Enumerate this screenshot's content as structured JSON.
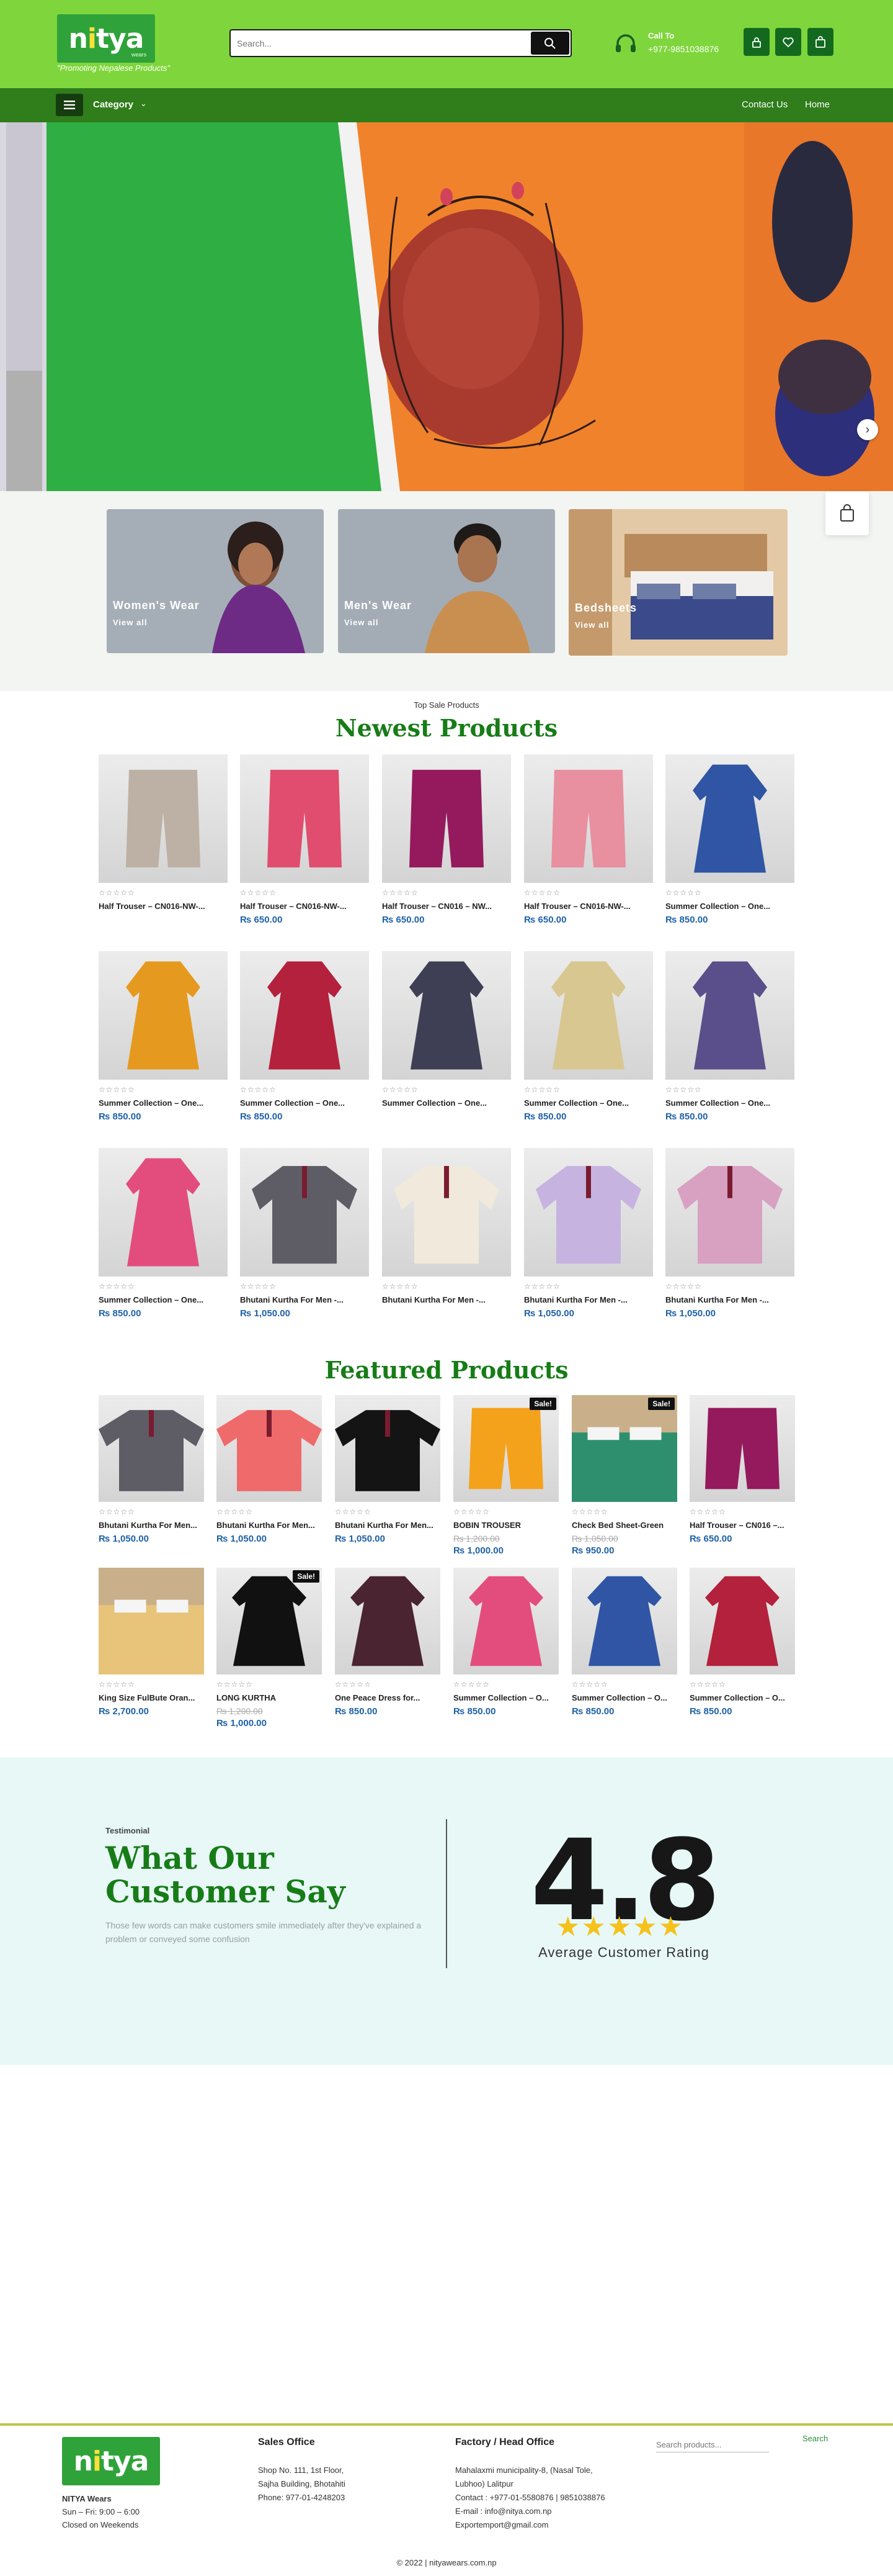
{
  "header": {
    "logo_text_pre": "n",
    "logo_dot": "i",
    "logo_text_post": "tya",
    "logo_sub": "wears",
    "tagline": "\"Promoting Nepalese Products\"",
    "search_placeholder": "Search...",
    "call_label": "Call To",
    "call_number": "+977-9851038876"
  },
  "nav": {
    "category": "Category",
    "links": [
      "Contact Us",
      "Home"
    ]
  },
  "categories": [
    {
      "title": "Women's Wear",
      "link": "View all"
    },
    {
      "title": "Men's Wear",
      "link": "View all"
    },
    {
      "title": "Bedsheets",
      "link": "View all"
    }
  ],
  "newest": {
    "kicker": "Top Sale Products",
    "title": "Newest Products",
    "products": [
      {
        "name": "Half Trouser – CN016-NW-...",
        "price": ""
      },
      {
        "name": "Half Trouser – CN016-NW-...",
        "price": "₨ 650.00"
      },
      {
        "name": "Half Trouser – CN016 – NW...",
        "price": "₨ 650.00"
      },
      {
        "name": "Half Trouser – CN016-NW-...",
        "price": "₨ 650.00"
      },
      {
        "name": "Summer Collection – One...",
        "price": "₨ 850.00"
      },
      {
        "name": "Summer Collection – One...",
        "price": "₨ 850.00"
      },
      {
        "name": "Summer Collection – One...",
        "price": "₨ 850.00"
      },
      {
        "name": "Summer Collection – One...",
        "price": ""
      },
      {
        "name": "Summer Collection – One...",
        "price": "₨ 850.00"
      },
      {
        "name": "Summer Collection – One...",
        "price": "₨ 850.00"
      },
      {
        "name": "Summer Collection – One...",
        "price": "₨ 850.00"
      },
      {
        "name": "Bhutani Kurtha For Men -...",
        "price": "₨ 1,050.00"
      },
      {
        "name": "Bhutani Kurtha For Men -...",
        "price": ""
      },
      {
        "name": "Bhutani Kurtha For Men -...",
        "price": "₨ 1,050.00"
      },
      {
        "name": "Bhutani Kurtha For Men -...",
        "price": "₨ 1,050.00"
      }
    ]
  },
  "featured": {
    "title": "Featured Products",
    "products": [
      {
        "name": "Bhutani Kurtha For Men...",
        "old": "",
        "price": "₨ 1,050.00",
        "sale": ""
      },
      {
        "name": "Bhutani Kurtha For Men...",
        "old": "",
        "price": "₨ 1,050.00",
        "sale": ""
      },
      {
        "name": "Bhutani Kurtha For Men...",
        "old": "",
        "price": "₨ 1,050.00",
        "sale": ""
      },
      {
        "name": "BOBIN TROUSER",
        "old": "₨ 1,200.00",
        "price": "₨ 1,000.00",
        "sale": "Sale!"
      },
      {
        "name": "Check Bed Sheet-Green",
        "old": "₨ 1,050.00",
        "price": "₨ 950.00",
        "sale": "Sale!"
      },
      {
        "name": "Half Trouser – CN016 –...",
        "old": "",
        "price": "₨ 650.00",
        "sale": ""
      },
      {
        "name": "King Size FulBute Oran...",
        "old": "",
        "price": "₨ 2,700.00",
        "sale": ""
      },
      {
        "name": "LONG KURTHA",
        "old": "₨ 1,200.00",
        "price": "₨ 1,000.00",
        "sale": "Sale!"
      },
      {
        "name": "One Peace Dress for...",
        "old": "",
        "price": "₨ 850.00",
        "sale": ""
      },
      {
        "name": "Summer Collection – O...",
        "old": "",
        "price": "₨ 850.00",
        "sale": ""
      },
      {
        "name": "Summer Collection – O...",
        "old": "",
        "price": "₨ 850.00",
        "sale": ""
      },
      {
        "name": "Summer Collection – O...",
        "old": "",
        "price": "₨ 850.00",
        "sale": ""
      }
    ]
  },
  "testimonial": {
    "kicker": "Testimonial",
    "title": "What Our Customer Say",
    "desc": "Those few words can make customers smile immediately after they've explained a problem or conveyed some confusion",
    "rating": "4.8",
    "rating_label": "Average Customer Rating"
  },
  "footer": {
    "brand": "NITYA Wears",
    "hours": "Sun – Fri: 9:00 – 6:00",
    "closed": "Closed on Weekends",
    "sales_head": "Sales Office",
    "sales_lines": [
      "Shop No. 111, 1st Floor,",
      "Sajha Building, Bhotahiti",
      "Phone: 977-01-4248203"
    ],
    "factory_head": "Factory / Head Office",
    "factory_lines": [
      "Mahalaxmi municipality-8, (Nasal Tole,",
      "Lubhoo) Lalitpur",
      "Contact : +977-01-5580876 | 9851038876",
      "E-mail : info@nitya.com.np",
      "Exportemport@gmail.com"
    ],
    "search_placeholder": "Search products...",
    "search_btn": "Search",
    "copyright": "© 2022 | nityawears.com.np"
  },
  "colors": {
    "header_green": "#7fd63c",
    "nav_green": "#2f7d1b",
    "title_green": "#177c17",
    "price_blue": "#1f62a7"
  }
}
